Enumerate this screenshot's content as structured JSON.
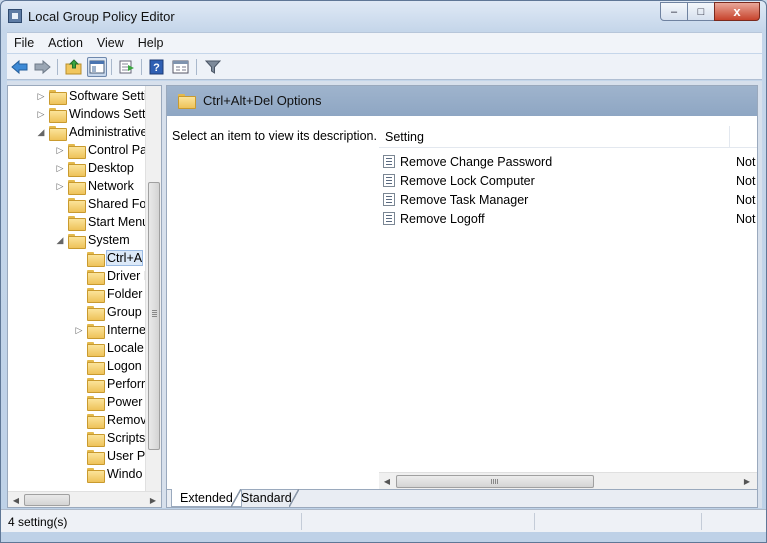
{
  "window": {
    "title": "Local Group Policy Editor",
    "min_glyph": "–",
    "max_glyph": "□",
    "close_glyph": "x"
  },
  "menu": [
    "File",
    "Action",
    "View",
    "Help"
  ],
  "tree": {
    "items": [
      {
        "label": "Software Setti",
        "arrow": "▷"
      },
      {
        "label": "Windows Sett",
        "arrow": "▷"
      },
      {
        "label": "Administrative",
        "arrow": "◢"
      },
      {
        "label": "Control Pa",
        "arrow": "▷"
      },
      {
        "label": "Desktop",
        "arrow": "▷"
      },
      {
        "label": "Network",
        "arrow": "▷"
      },
      {
        "label": "Shared Fol",
        "arrow": ""
      },
      {
        "label": "Start Menu",
        "arrow": ""
      },
      {
        "label": "System",
        "arrow": "◢"
      },
      {
        "label": "Ctrl+A",
        "arrow": ""
      },
      {
        "label": "Driver I",
        "arrow": ""
      },
      {
        "label": "Folder",
        "arrow": ""
      },
      {
        "label": "Group",
        "arrow": ""
      },
      {
        "label": "Interne",
        "arrow": "▷"
      },
      {
        "label": "Locale",
        "arrow": ""
      },
      {
        "label": "Logon",
        "arrow": ""
      },
      {
        "label": "Perforr",
        "arrow": ""
      },
      {
        "label": "Power",
        "arrow": ""
      },
      {
        "label": "Remov",
        "arrow": ""
      },
      {
        "label": "Scripts",
        "arrow": ""
      },
      {
        "label": "User Pr",
        "arrow": ""
      },
      {
        "label": "Windo",
        "arrow": ""
      }
    ],
    "selected_label": "Ctrl+A"
  },
  "details": {
    "title": "Ctrl+Alt+Del Options",
    "description": "Select an item to view its description.",
    "column_setting": "Setting",
    "settings": [
      {
        "name": "Remove Change Password",
        "state": "Not"
      },
      {
        "name": "Remove Lock Computer",
        "state": "Not"
      },
      {
        "name": "Remove Task Manager",
        "state": "Not"
      },
      {
        "name": "Remove Logoff",
        "state": "Not"
      }
    ]
  },
  "tabs": {
    "extended": "Extended",
    "standard": "Standard",
    "active": "Extended"
  },
  "status": {
    "text": "4 setting(s)"
  },
  "colors": {
    "accent": "#8ea6c3",
    "selection": "#dce9f8",
    "folder": "#eec25a"
  }
}
